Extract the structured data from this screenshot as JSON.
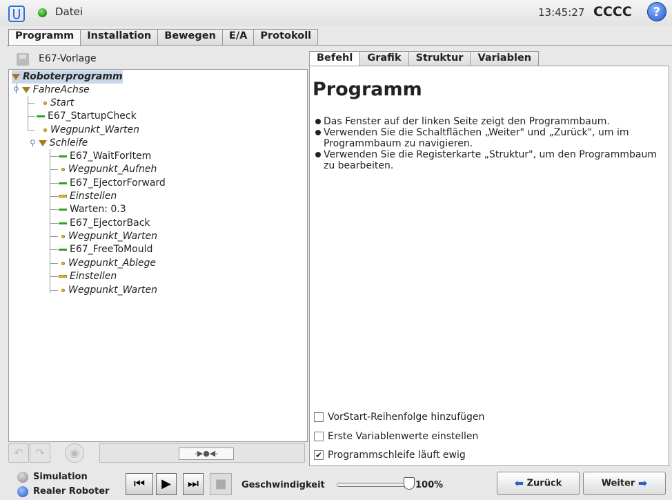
{
  "header": {
    "file_label": "Datei",
    "time": "13:45:27",
    "robot_name": "CCCC",
    "help_label": "?"
  },
  "main_tabs": [
    {
      "label": "Programm",
      "active": true
    },
    {
      "label": "Installation",
      "active": false
    },
    {
      "label": "Bewegen",
      "active": false
    },
    {
      "label": "E/A",
      "active": false
    },
    {
      "label": "Protokoll",
      "active": false
    }
  ],
  "program": {
    "name": "E67-Vorlage"
  },
  "tree": [
    {
      "label": "Roboterprogramm",
      "kind": "root"
    },
    {
      "label": "FahreAchse",
      "kind": "folder"
    },
    {
      "label": "Start",
      "kind": "waypoint"
    },
    {
      "label": "E67_StartupCheck",
      "kind": "command"
    },
    {
      "label": "Wegpunkt_Warten",
      "kind": "waypoint"
    },
    {
      "label": "Schleife",
      "kind": "folder"
    },
    {
      "label": "E67_WaitForItem",
      "kind": "command"
    },
    {
      "label": "Wegpunkt_Aufneh",
      "kind": "waypoint"
    },
    {
      "label": "E67_EjectorForward",
      "kind": "command"
    },
    {
      "label": "Einstellen",
      "kind": "set"
    },
    {
      "label": "Warten: 0.3",
      "kind": "command"
    },
    {
      "label": "E67_EjectorBack",
      "kind": "command"
    },
    {
      "label": "Wegpunkt_Warten",
      "kind": "waypoint"
    },
    {
      "label": "E67_FreeToMould",
      "kind": "command"
    },
    {
      "label": "Wegpunkt_Ablege",
      "kind": "waypoint"
    },
    {
      "label": "Einstellen",
      "kind": "set"
    },
    {
      "label": "Wegpunkt_Warten",
      "kind": "waypoint"
    }
  ],
  "sub_tabs": [
    {
      "label": "Befehl",
      "active": true
    },
    {
      "label": "Grafik",
      "active": false
    },
    {
      "label": "Struktur",
      "active": false
    },
    {
      "label": "Variablen",
      "active": false
    }
  ],
  "panel": {
    "title": "Programm",
    "bullets": [
      "Das Fenster auf der linken Seite zeigt den Programmbaum.",
      "Verwenden Sie die Schaltflächen „Weiter\" und „Zurück\", um im Programmbaum zu navigieren.",
      "Verwenden Sie die Registerkarte „Struktur\", um den Programmbaum zu bearbeiten."
    ],
    "checkboxes": [
      {
        "label": "VorStart-Reihenfolge hinzufügen",
        "checked": false
      },
      {
        "label": "Erste Variablenwerte einstellen",
        "checked": false
      },
      {
        "label": "Programmschleife läuft ewig",
        "checked": true
      }
    ]
  },
  "bottom": {
    "simulation_label": "Simulation",
    "real_robot_label": "Realer Roboter",
    "speed_label": "Geschwindigkeit",
    "speed_value": "100%",
    "speed_fraction": 1.0,
    "back_label": "Zurück",
    "next_label": "Weiter"
  },
  "colors": {
    "accent": "#2c6fd6",
    "command": "#2ea21f",
    "waypoint": "#e3b81f",
    "folder": "#a57a1c"
  }
}
